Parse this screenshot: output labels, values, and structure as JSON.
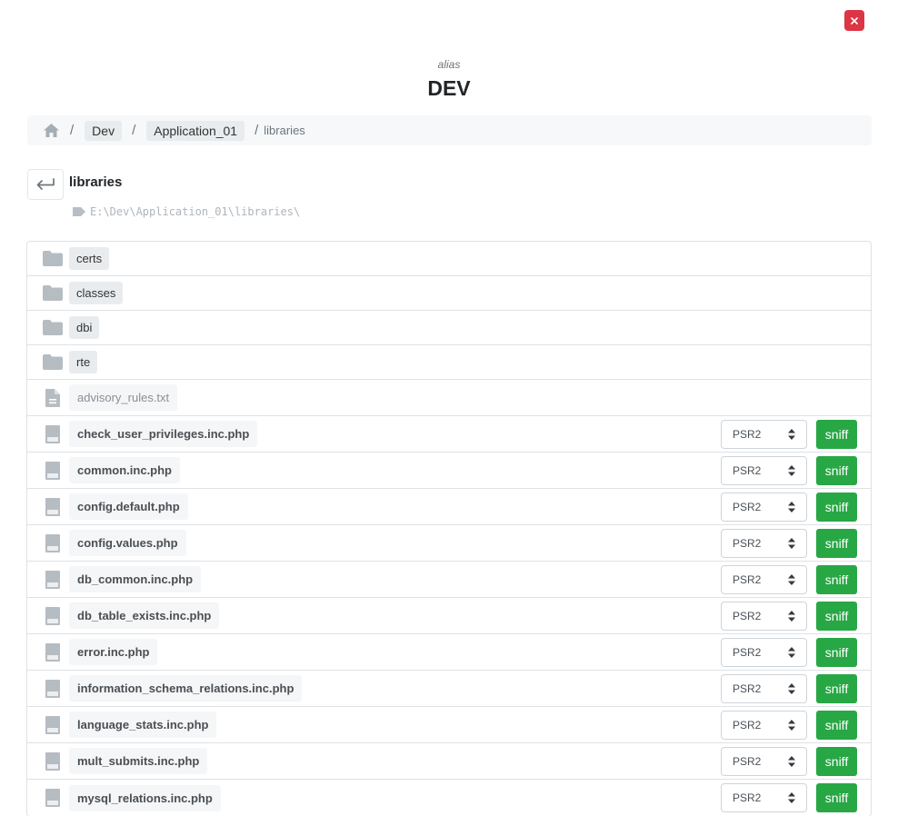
{
  "header": {
    "alias_label": "alias",
    "title": "DEV"
  },
  "breadcrumb": {
    "home_icon": "home-icon",
    "separator": "/",
    "items": [
      "Dev",
      "Application_01"
    ],
    "current": "libraries"
  },
  "directory": {
    "back_icon": "return-arrow-icon",
    "name": "libraries",
    "path": "E:\\Dev\\Application_01\\libraries\\"
  },
  "folders": [
    {
      "name": "certs",
      "icon": "folder-icon"
    },
    {
      "name": "classes",
      "icon": "folder-icon"
    },
    {
      "name": "dbi",
      "icon": "folder-icon"
    },
    {
      "name": "rte",
      "icon": "folder-icon"
    }
  ],
  "text_files": [
    {
      "name": "advisory_rules.txt",
      "icon": "text-file-icon"
    }
  ],
  "php_files": [
    {
      "name": "check_user_privileges.inc.php",
      "standard": "PSR2",
      "action": "sniff"
    },
    {
      "name": "common.inc.php",
      "standard": "PSR2",
      "action": "sniff"
    },
    {
      "name": "config.default.php",
      "standard": "PSR2",
      "action": "sniff"
    },
    {
      "name": "config.values.php",
      "standard": "PSR2",
      "action": "sniff"
    },
    {
      "name": "db_common.inc.php",
      "standard": "PSR2",
      "action": "sniff"
    },
    {
      "name": "db_table_exists.inc.php",
      "standard": "PSR2",
      "action": "sniff"
    },
    {
      "name": "error.inc.php",
      "standard": "PSR2",
      "action": "sniff"
    },
    {
      "name": "information_schema_relations.inc.php",
      "standard": "PSR2",
      "action": "sniff"
    },
    {
      "name": "language_stats.inc.php",
      "standard": "PSR2",
      "action": "sniff"
    },
    {
      "name": "mult_submits.inc.php",
      "standard": "PSR2",
      "action": "sniff"
    },
    {
      "name": "mysql_relations.inc.php",
      "standard": "PSR2",
      "action": "sniff"
    }
  ],
  "colors": {
    "close_button": "#dc3545",
    "sniff_button": "#28a745",
    "icon_gray": "#b5bcc2"
  }
}
